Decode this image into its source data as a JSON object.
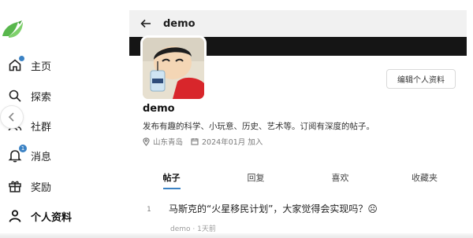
{
  "colors": {
    "accent": "#3b82c4",
    "logo": "#59b74d",
    "topbar_bg": "#f1f1f1",
    "banner_bg": "#151515"
  },
  "sidebar": {
    "logo_icon": "bird-logo-icon",
    "items": [
      {
        "label": "主页",
        "icon": "home-icon",
        "has_dot": true
      },
      {
        "label": "探索",
        "icon": "search-icon"
      },
      {
        "label": "社群",
        "icon": "users-icon"
      },
      {
        "label": "消息",
        "icon": "bell-icon",
        "badge": "1"
      },
      {
        "label": "奖励",
        "icon": "gift-icon"
      },
      {
        "label": "个人资料",
        "icon": "user-icon",
        "active": true
      }
    ]
  },
  "header": {
    "title": "demo",
    "back_icon": "arrow-left-icon"
  },
  "profile": {
    "name": "demo",
    "bio": "发布有趣的科学、小玩意、历史、艺术等。订阅有深度的帖子。",
    "location": "山东青岛",
    "joined": "2024年01月 加入",
    "edit_button": "编辑个人资料"
  },
  "tabs": [
    {
      "label": "帖子",
      "active": true
    },
    {
      "label": "回复"
    },
    {
      "label": "喜欢"
    },
    {
      "label": "收藏夹"
    }
  ],
  "posts": [
    {
      "rank": "1",
      "title": "马斯克的“火星移民计划”，大家觉得会实现吗？☹",
      "meta": "demo · 1天前"
    }
  ]
}
